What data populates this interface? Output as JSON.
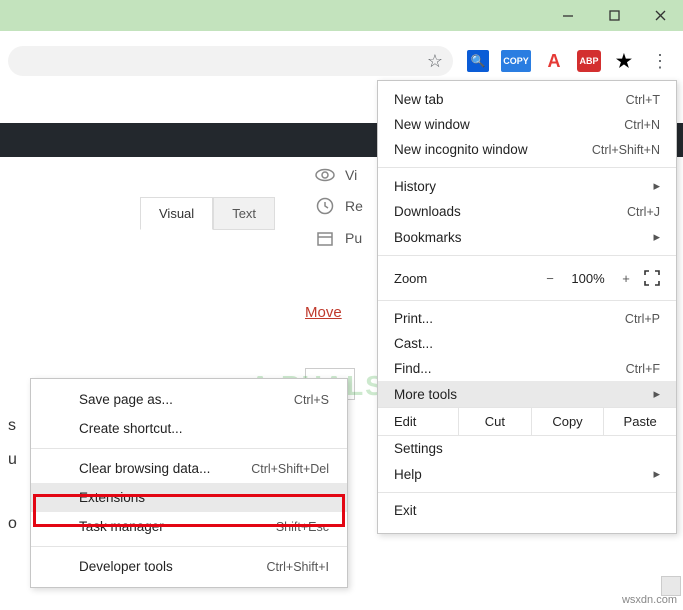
{
  "window": {
    "minimize": "—",
    "maximize": "▢",
    "close": "✕"
  },
  "toolbar": {
    "star": "☆",
    "ext1_label": "🔍",
    "ext2_label": "COPY",
    "ext3_label": "A",
    "ext4_label": "ABP",
    "ext5_label": "★",
    "menu_dots": "⋮"
  },
  "page": {
    "tab_visual": "Visual",
    "tab_text": "Text",
    "icon_vi": "Vi",
    "icon_re": "Re",
    "icon_pu": "Pu",
    "move_link": "Move",
    "partial1": "s",
    "partial2": "u",
    "partial3": "o"
  },
  "menu": {
    "new_tab": {
      "label": "New tab",
      "shortcut": "Ctrl+T"
    },
    "new_window": {
      "label": "New window",
      "shortcut": "Ctrl+N"
    },
    "new_incognito": {
      "label": "New incognito window",
      "shortcut": "Ctrl+Shift+N"
    },
    "history": {
      "label": "History",
      "sub": "▸"
    },
    "downloads": {
      "label": "Downloads",
      "shortcut": "Ctrl+J"
    },
    "bookmarks": {
      "label": "Bookmarks",
      "sub": "▸"
    },
    "zoom": {
      "label": "Zoom",
      "minus": "−",
      "pct": "100%",
      "plus": "+"
    },
    "print": {
      "label": "Print...",
      "shortcut": "Ctrl+P"
    },
    "cast": {
      "label": "Cast..."
    },
    "find": {
      "label": "Find...",
      "shortcut": "Ctrl+F"
    },
    "more_tools": {
      "label": "More tools",
      "sub": "▸"
    },
    "edit": {
      "label": "Edit",
      "cut": "Cut",
      "copy": "Copy",
      "paste": "Paste"
    },
    "settings": {
      "label": "Settings"
    },
    "help": {
      "label": "Help",
      "sub": "▸"
    },
    "exit": {
      "label": "Exit"
    }
  },
  "submenu": {
    "save_page": {
      "label": "Save page as...",
      "shortcut": "Ctrl+S"
    },
    "create_shortcut": {
      "label": "Create shortcut..."
    },
    "clear_data": {
      "label": "Clear browsing data...",
      "shortcut": "Ctrl+Shift+Del"
    },
    "extensions": {
      "label": "Extensions"
    },
    "task_manager": {
      "label": "Task manager",
      "shortcut": "Shift+Esc"
    },
    "dev_tools": {
      "label": "Developer tools",
      "shortcut": "Ctrl+Shift+I"
    }
  },
  "watermark": "A  PUALS",
  "footer": "wsxdn.com"
}
